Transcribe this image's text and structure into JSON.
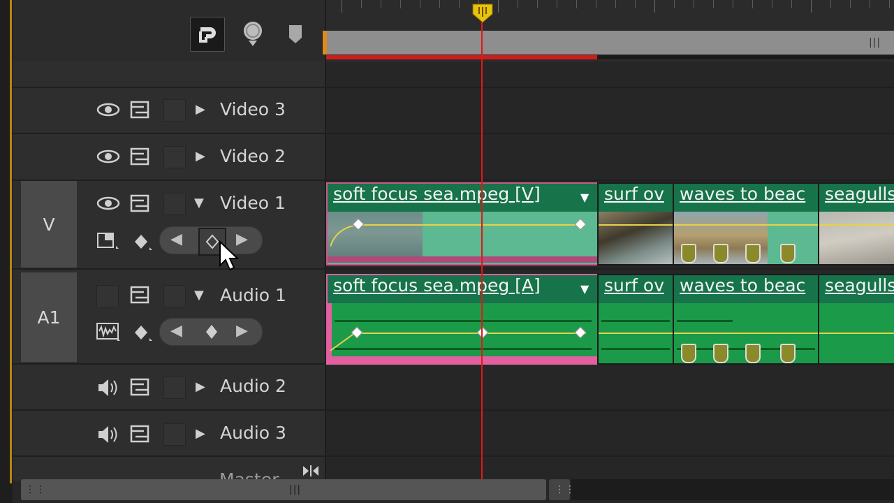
{
  "toolbar": {
    "snap_icon": "snap-magnet-icon",
    "marker_icon": "add-marker-icon",
    "bookmark_icon": "bookmark-icon"
  },
  "tracks": {
    "video3": {
      "name": "Video 3"
    },
    "video2": {
      "name": "Video 2"
    },
    "video1": {
      "name": "Video 1",
      "source_label": "V"
    },
    "audio1": {
      "name": "Audio 1",
      "source_label": "A1"
    },
    "audio2": {
      "name": "Audio 2"
    },
    "audio3": {
      "name": "Audio 3"
    },
    "master": {
      "name": "Master"
    }
  },
  "clips": {
    "video": [
      {
        "title": "soft focus sea.mpeg [V]"
      },
      {
        "title": "surf ov"
      },
      {
        "title": "waves to beac"
      },
      {
        "title": "seagulls"
      }
    ],
    "audio": [
      {
        "title": "soft focus sea.mpeg [A]"
      },
      {
        "title": "surf ov"
      },
      {
        "title": "waves to beac"
      },
      {
        "title": "seagulls"
      }
    ]
  },
  "colors": {
    "clip_green": "#5cb992",
    "clip_audio_green": "#1b9a4a",
    "selected_magenta": "#c85a8a",
    "playhead": "#e01818",
    "render_bar": "#d11a1a",
    "keyframe_line": "#e6d24a"
  }
}
